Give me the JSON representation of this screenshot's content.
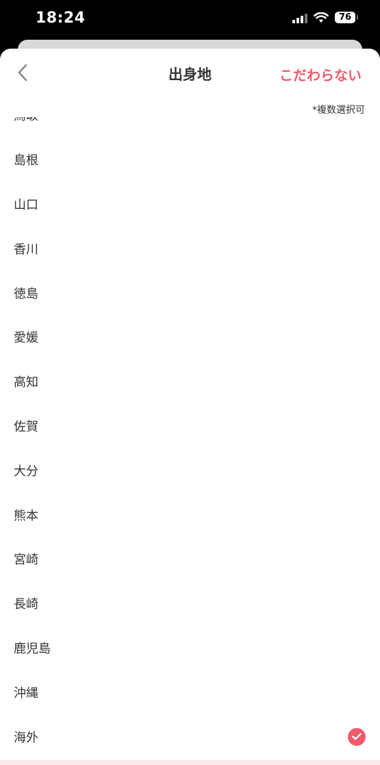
{
  "status_bar": {
    "time": "18:24",
    "battery": "76"
  },
  "header": {
    "title": "出身地",
    "no_preference_label": "こだわらない"
  },
  "note": "*複数選択可",
  "list": {
    "items": [
      {
        "label": "鳥取",
        "selected": false
      },
      {
        "label": "島根",
        "selected": false
      },
      {
        "label": "山口",
        "selected": false
      },
      {
        "label": "香川",
        "selected": false
      },
      {
        "label": "徳島",
        "selected": false
      },
      {
        "label": "愛媛",
        "selected": false
      },
      {
        "label": "高知",
        "selected": false
      },
      {
        "label": "佐賀",
        "selected": false
      },
      {
        "label": "大分",
        "selected": false
      },
      {
        "label": "熊本",
        "selected": false
      },
      {
        "label": "宮崎",
        "selected": false
      },
      {
        "label": "長崎",
        "selected": false
      },
      {
        "label": "鹿児島",
        "selected": false
      },
      {
        "label": "沖縄",
        "selected": false
      },
      {
        "label": "海外",
        "selected": true
      }
    ]
  },
  "colors": {
    "accent": "#f05a6b",
    "text": "#333333"
  }
}
